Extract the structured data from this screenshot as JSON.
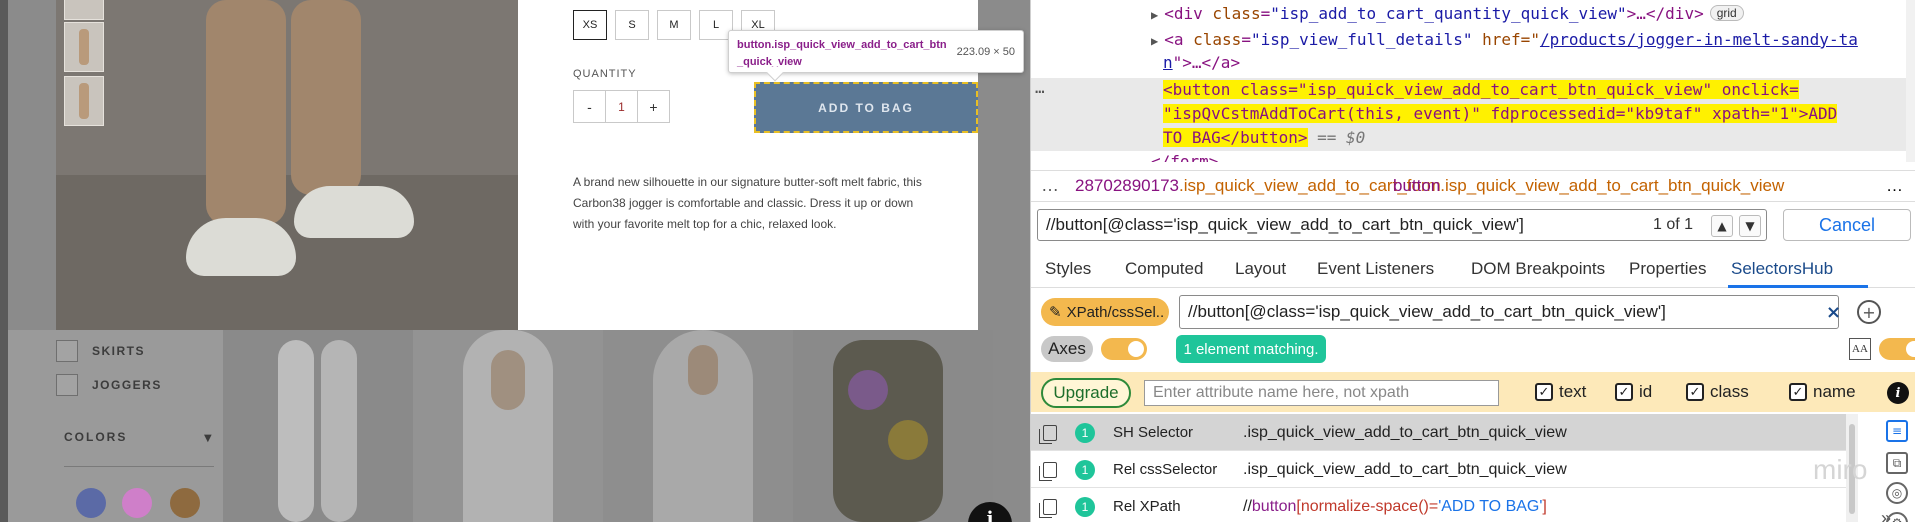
{
  "webpage": {
    "sizes": [
      "XS",
      "S",
      "M",
      "L",
      "XL"
    ],
    "selected_size": "XS",
    "quantity_label": "QUANTITY",
    "qty_minus": "-",
    "qty_value": "1",
    "qty_plus": "+",
    "add_to_bag": "ADD TO BAG",
    "description": "A brand new silhouette in our signature butter-soft melt fabric, this Carbon38 jogger is comfortable and classic. Dress it up or down with your favorite melt top for a chic, relaxed look.",
    "tooltip_tag": "button",
    "tooltip_class": ".isp_quick_view_add_to_cart_btn_quick_view",
    "tooltip_size": "223.09 × 50",
    "filters": [
      "SKIRTS",
      "JOGGERS"
    ],
    "colors_heading": "COLORS",
    "color_swatches": [
      "#5b6aa6",
      "#cf7fc9",
      "#8e6a3f"
    ],
    "info_glyph": "i"
  },
  "devtools": {
    "dom": {
      "line1_open": "<div ",
      "line1_attr": "class",
      "line1_val": "\"isp_add_to_cart_quantity_quick_view\"",
      "line1_rest": ">…</div>",
      "grid_badge": "grid",
      "line2_open": "<a ",
      "line2_attr1": "class",
      "line2_val1": "\"isp_view_full_details\"",
      "line2_attr2": " href=\"",
      "line2_link": "/products/jogger-in-melt-sandy-ta",
      "line3_link": "n",
      "line3_rest": "\">…</a>",
      "hl_line1": "<button class=\"isp_quick_view_add_to_cart_btn_quick_view\" onclick=",
      "hl_line2": "\"ispQvCstmAddToCart(this, event)\" fdprocessedid=\"kb9taf\" xpath=\"1\">ADD",
      "hl_line3": "TO BAG</button>",
      "eq0": " == $0",
      "line_form": "</form>",
      "dots": "…"
    },
    "breadcrumbs": {
      "dots": "…",
      "crumb1_prefix": "28702890173",
      "crumb1_class": ".isp_quick_view_add_to_cart_form",
      "crumb2_tag": "button",
      "crumb2_class": ".isp_quick_view_add_to_cart_btn_quick_view",
      "more": "…"
    },
    "search": {
      "value": "//button[@class='isp_quick_view_add_to_cart_btn_quick_view']",
      "count": "1 of 1",
      "up": "▲",
      "down": "▼",
      "cancel": "Cancel"
    },
    "tabs": [
      "Styles",
      "Computed",
      "Layout",
      "Event Listeners",
      "DOM Breakpoints",
      "Properties",
      "SelectorsHub"
    ],
    "tabs_more": "»",
    "selectorshub": {
      "mode_label": "XPath/cssSel..",
      "selector_value": "//button[@class='isp_quick_view_add_to_cart_btn_quick_view']",
      "clear": "×",
      "add": "+",
      "axes": "Axes",
      "match_badge": "1 element matching.",
      "aa": "A͏A",
      "upgrade": "Upgrade",
      "attr_placeholder": "Enter attribute name here, not xpath",
      "checkboxes": [
        "text",
        "id",
        "class",
        "name"
      ],
      "check_glyph": "✓",
      "info": "i"
    },
    "results": [
      {
        "count": "1",
        "name": "SH Selector",
        "value": ".isp_quick_view_add_to_cart_btn_quick_view"
      },
      {
        "count": "1",
        "name": "Rel cssSelector",
        "value": ".isp_quick_view_add_to_cart_btn_quick_view"
      },
      {
        "count": "1",
        "name": "Rel XPath",
        "value_prefix": "//",
        "value_tag": "button",
        "value_fn": "[normalize-space()=",
        "value_str": "'ADD TO BAG'",
        "value_end": "]"
      }
    ],
    "watermark": "miro"
  },
  "colors": {
    "add_button": "#5b7895",
    "highlight": "#fff100",
    "accent_blue": "#1a73e8",
    "sh_orange": "#f3b84e",
    "match_green": "#1fc59a"
  }
}
